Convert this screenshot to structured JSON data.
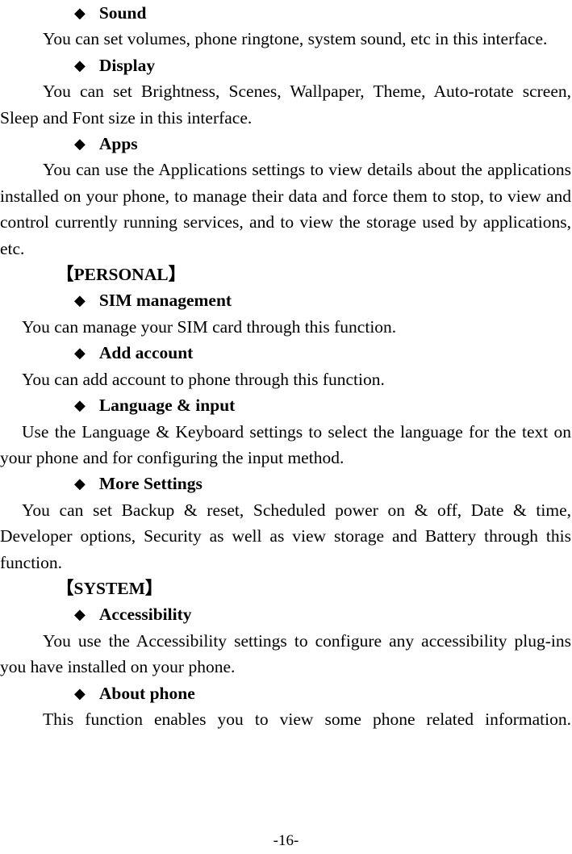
{
  "document": {
    "bullet_glyph": "◆",
    "page_number": "-16-",
    "blocks": [
      {
        "kind": "heading",
        "title": "Sound"
      },
      {
        "kind": "para",
        "text": "You can set volumes, phone ringtone, system sound, etc in this interface."
      },
      {
        "kind": "heading",
        "title": "Display"
      },
      {
        "kind": "para",
        "text": "You can set Brightness, Scenes, Wallpaper, Theme, Auto-rotate screen, Sleep and Font size in this interface."
      },
      {
        "kind": "heading",
        "title": "Apps"
      },
      {
        "kind": "para",
        "text": "You can use the Applications settings to view details about the applications installed on your phone, to manage their data and force them to stop, to view and control currently running services, and to view the storage used by applications, etc."
      },
      {
        "kind": "section",
        "text": "【PERSONAL】"
      },
      {
        "kind": "heading",
        "title": "SIM management"
      },
      {
        "kind": "para",
        "text": "You can manage your SIM card through this function."
      },
      {
        "kind": "heading",
        "title": "Add account"
      },
      {
        "kind": "para",
        "text": "You can add account to phone through this function."
      },
      {
        "kind": "heading",
        "title": "Language & input"
      },
      {
        "kind": "para",
        "text": "Use the Language & Keyboard settings to select the language for the text on your phone and for configuring the input method."
      },
      {
        "kind": "heading",
        "title": "More Settings"
      },
      {
        "kind": "para",
        "text": "You can set Backup & reset, Scheduled power on & off, Date & time, Developer options, Security as well as view storage and Battery through this function."
      },
      {
        "kind": "section",
        "text": "【SYSTEM】"
      },
      {
        "kind": "heading",
        "title": "Accessibility"
      },
      {
        "kind": "para",
        "text": "You use the Accessibility settings to configure any accessibility plug-ins you have installed on your phone."
      },
      {
        "kind": "heading",
        "title": "About phone"
      },
      {
        "kind": "para",
        "text": "This function enables you to view some phone related information."
      }
    ]
  }
}
